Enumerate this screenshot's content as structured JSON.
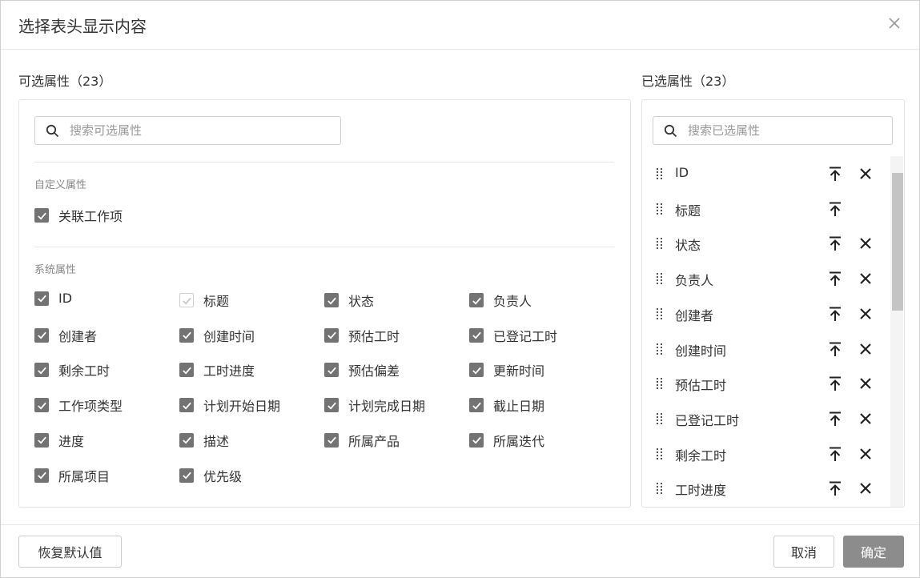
{
  "dialog": {
    "title": "选择表头显示内容",
    "close_icon": "close-icon"
  },
  "available": {
    "title": "可选属性（23）",
    "search_placeholder": "搜索可选属性",
    "groups": [
      {
        "title": "自定义属性",
        "items": [
          {
            "label": "关联工作项",
            "checked": true,
            "disabled": false
          }
        ]
      },
      {
        "title": "系统属性",
        "items": [
          {
            "label": "ID",
            "checked": true,
            "disabled": false
          },
          {
            "label": "标题",
            "checked": true,
            "disabled": true
          },
          {
            "label": "状态",
            "checked": true,
            "disabled": false
          },
          {
            "label": "负责人",
            "checked": true,
            "disabled": false
          },
          {
            "label": "创建者",
            "checked": true,
            "disabled": false
          },
          {
            "label": "创建时间",
            "checked": true,
            "disabled": false
          },
          {
            "label": "预估工时",
            "checked": true,
            "disabled": false
          },
          {
            "label": "已登记工时",
            "checked": true,
            "disabled": false
          },
          {
            "label": "剩余工时",
            "checked": true,
            "disabled": false
          },
          {
            "label": "工时进度",
            "checked": true,
            "disabled": false
          },
          {
            "label": "预估偏差",
            "checked": true,
            "disabled": false
          },
          {
            "label": "更新时间",
            "checked": true,
            "disabled": false
          },
          {
            "label": "工作项类型",
            "checked": true,
            "disabled": false
          },
          {
            "label": "计划开始日期",
            "checked": true,
            "disabled": false
          },
          {
            "label": "计划完成日期",
            "checked": true,
            "disabled": false
          },
          {
            "label": "截止日期",
            "checked": true,
            "disabled": false
          },
          {
            "label": "进度",
            "checked": true,
            "disabled": false
          },
          {
            "label": "描述",
            "checked": true,
            "disabled": false
          },
          {
            "label": "所属产品",
            "checked": true,
            "disabled": false
          },
          {
            "label": "所属迭代",
            "checked": true,
            "disabled": false
          },
          {
            "label": "所属项目",
            "checked": true,
            "disabled": false
          },
          {
            "label": "优先级",
            "checked": true,
            "disabled": false
          }
        ]
      }
    ]
  },
  "selected": {
    "title": "已选属性（23）",
    "search_placeholder": "搜索已选属性",
    "items": [
      {
        "label": "ID",
        "removable": true
      },
      {
        "label": "标题",
        "removable": false
      },
      {
        "label": "状态",
        "removable": true
      },
      {
        "label": "负责人",
        "removable": true
      },
      {
        "label": "创建者",
        "removable": true
      },
      {
        "label": "创建时间",
        "removable": true
      },
      {
        "label": "预估工时",
        "removable": true
      },
      {
        "label": "已登记工时",
        "removable": true
      },
      {
        "label": "剩余工时",
        "removable": true
      },
      {
        "label": "工时进度",
        "removable": true
      }
    ]
  },
  "footer": {
    "reset_label": "恢复默认值",
    "cancel_label": "取消",
    "confirm_label": "确定"
  },
  "colors": {
    "checkbox": "#737373",
    "primary_button": "#8c8c8c",
    "scroll_thumb": "#c4c4c4"
  }
}
